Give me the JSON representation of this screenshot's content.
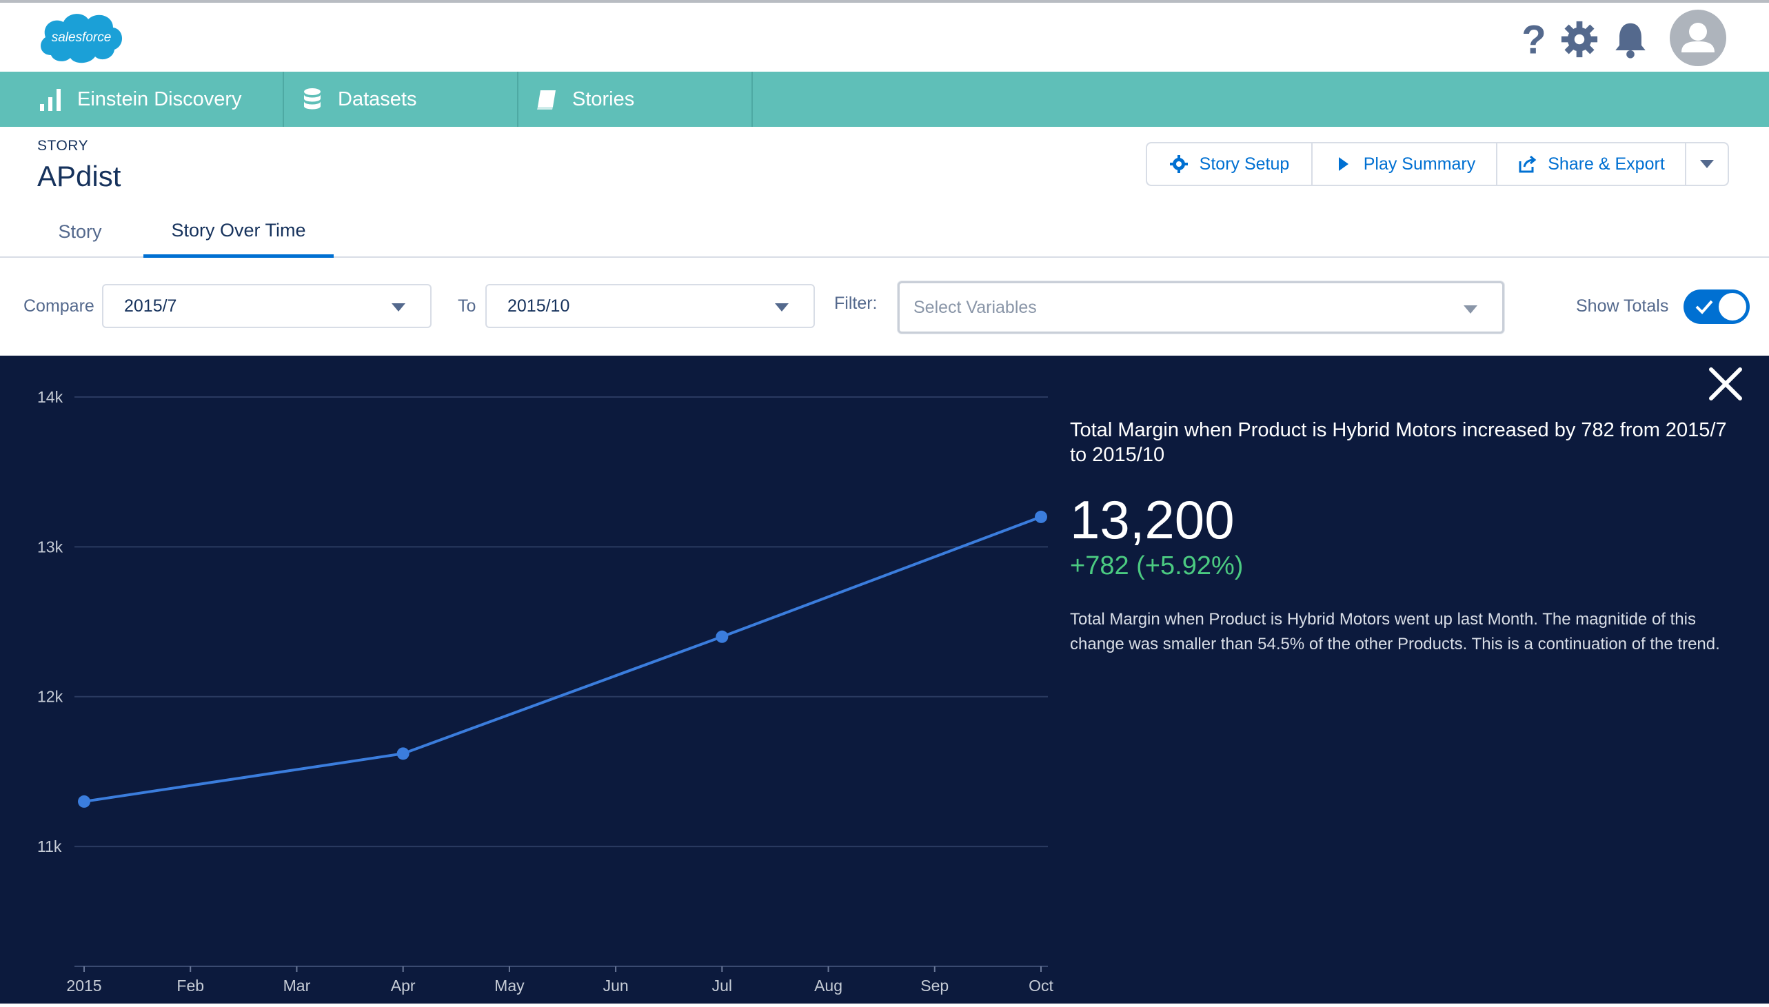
{
  "header": {
    "logo_text": "salesforce",
    "icons": [
      "help-icon",
      "gear-icon",
      "bell-icon",
      "user-avatar-icon"
    ]
  },
  "nav": {
    "items": [
      {
        "label": "Einstein Discovery",
        "icon": "bar-chart-icon"
      },
      {
        "label": "Datasets",
        "icon": "database-icon"
      },
      {
        "label": "Stories",
        "icon": "book-icon"
      }
    ]
  },
  "story": {
    "eyebrow": "STORY",
    "title": "APdist"
  },
  "actions": {
    "setup": "Story Setup",
    "play": "Play Summary",
    "share": "Share & Export"
  },
  "tabs": {
    "story": "Story",
    "over_time": "Story Over Time"
  },
  "filters": {
    "compare_label": "Compare",
    "compare_value": "2015/7",
    "to_label": "To",
    "to_value": "2015/10",
    "filter_label": "Filter:",
    "filter_placeholder": "Select Variables",
    "show_totals_label": "Show Totals",
    "show_totals": true
  },
  "insight": {
    "title": "Total Margin when Product is Hybrid Motors increased by 782 from 2015/7 to 2015/10",
    "value": "13,200",
    "change": "+782 (+5.92%)",
    "description": "Total Margin when Product is Hybrid Motors went up last Month. The magnitide of this change was smaller than 54.5% of the other Products. This is a continuation of the trend."
  },
  "colors": {
    "nav_bg": "#5fbfb8",
    "panel_bg": "#0c1a3d",
    "line": "#3b7ddd",
    "positive": "#4bca81",
    "accent": "#0070d2"
  },
  "chart_data": {
    "type": "line",
    "x_ticks": [
      "2015",
      "Feb",
      "Mar",
      "Apr",
      "May",
      "Jun",
      "Jul",
      "Aug",
      "Sep",
      "Oct"
    ],
    "y_ticks": [
      "14k",
      "13k",
      "12k",
      "11k"
    ],
    "y_tick_values": [
      14000,
      13000,
      12000,
      11000
    ],
    "ylim": [
      10200,
      14000
    ],
    "series": [
      {
        "points": [
          {
            "x": 0,
            "y": 11300
          },
          {
            "x": 3,
            "y": 11620
          },
          {
            "x": 6,
            "y": 12400
          },
          {
            "x": 9,
            "y": 13200
          }
        ]
      }
    ],
    "grid": true,
    "title": "",
    "xlabel": "",
    "ylabel": ""
  }
}
